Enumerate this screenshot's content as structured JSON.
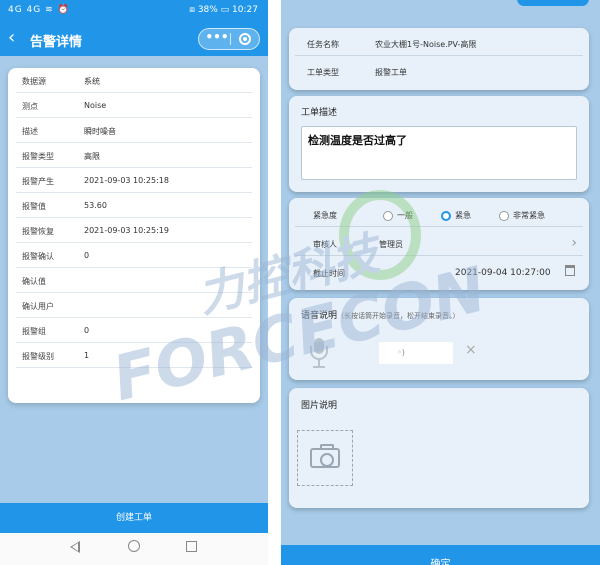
{
  "left": {
    "status_bar": {
      "left": "4G 4G ≋ ⏰",
      "right": "⧈ 38% ▭ 10:27"
    },
    "app_bar": {
      "back": "‹",
      "title": "告警详情",
      "more": "•••"
    },
    "details": [
      {
        "label": "数据源",
        "value": "系统"
      },
      {
        "label": "测点",
        "value": "Noise"
      },
      {
        "label": "描述",
        "value": "瞬时噪音"
      },
      {
        "label": "报警类型",
        "value": "高限"
      },
      {
        "label": "报警产生",
        "value": "2021-09-03 10:25:18"
      },
      {
        "label": "报警值",
        "value": "53.60"
      },
      {
        "label": "报警恢复",
        "value": "2021-09-03 10:25:19"
      },
      {
        "label": "报警确认",
        "value": "0"
      },
      {
        "label": "确认值",
        "value": ""
      },
      {
        "label": "确认用户",
        "value": ""
      },
      {
        "label": "报警组",
        "value": "0"
      },
      {
        "label": "报警级别",
        "value": "1"
      }
    ],
    "create_button": "创建工单"
  },
  "right": {
    "task": {
      "name_label": "任务名称",
      "name_value": "农业大棚1号-Noise.PV-高限",
      "type_label": "工单类型",
      "type_value": "报警工单"
    },
    "description": {
      "title": "工单描述",
      "text": "检测温度是否过高了"
    },
    "urgency": {
      "label": "紧急度",
      "options": [
        "一般",
        "紧急",
        "非常紧急"
      ],
      "selected": "紧急"
    },
    "reviewer": {
      "label": "审核人",
      "value": "管理员"
    },
    "deadline": {
      "label": "截止时间",
      "value": "2021-09-04 10:27:00"
    },
    "voice": {
      "title": "语音说明",
      "hint": "（长按话筒开始录音，松开结束录音。）",
      "chip": "◦)",
      "close": "×"
    },
    "photo": {
      "title": "图片说明"
    },
    "confirm_button": "确定"
  },
  "watermark": {
    "cn": "力控科技",
    "en": "FORCECON"
  },
  "colors": {
    "primary": "#2196e8",
    "background": "#a7cbe9",
    "card": "#e8f1fa"
  }
}
